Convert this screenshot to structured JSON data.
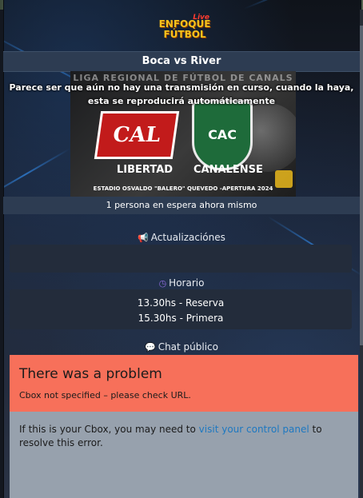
{
  "header": {
    "logo_live": "Live",
    "logo_line1": "ENFOQUE",
    "logo_line2": "FÚTBOL"
  },
  "match": {
    "title": "Boca vs River",
    "notice": "Parece ser que aún no hay una transmisión en curso, cuando la haya, esta se reproducirá automáticamente",
    "waiting": "1 persona en espera ahora mismo"
  },
  "poster": {
    "league": "LIGA REGIONAL DE FÚTBOL DE CANALS",
    "left_crest": "CAL",
    "right_crest": "CAC",
    "team_left": "LIBERTAD",
    "team_right": "CANALENSE",
    "stadium": "ESTADIO OSVALDO \"BALERO\" QUEVEDO -APERTURA 2024"
  },
  "updates": {
    "title": "Actualizaciónes",
    "icon": "megaphone-icon"
  },
  "schedule": {
    "title": "Horario",
    "icon": "clock-icon",
    "lines": [
      "13.30hs - Reserva",
      "15.30hs - Primera"
    ]
  },
  "chat": {
    "title": "Chat público",
    "icon": "speech-bubble-icon",
    "error_title": "There was a problem",
    "error_subtitle": "Cbox not specified – please check URL.",
    "error_text_before": "If this is your Cbox, you may need to ",
    "error_link": "visit your control panel",
    "error_text_after": " to resolve this error."
  },
  "colors": {
    "bar": "#2d3c52",
    "error_header": "#f7705a",
    "error_body": "#97a1ad",
    "link": "#1d78c1"
  }
}
